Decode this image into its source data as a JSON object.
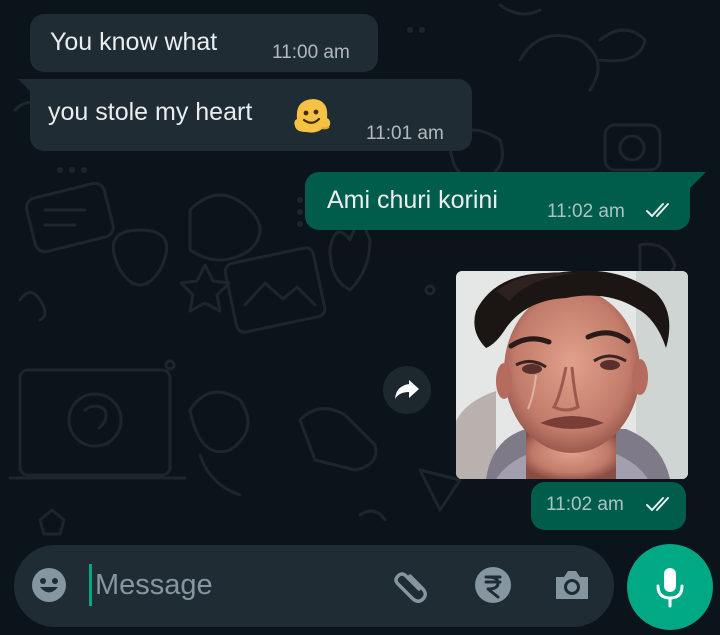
{
  "chat": {
    "messages": [
      {
        "direction": "incoming",
        "text": "You know what",
        "time": "11:00 am"
      },
      {
        "direction": "incoming",
        "text": "you stole my heart",
        "emoji": "melting-face",
        "time": "11:01 am"
      },
      {
        "direction": "outgoing",
        "text": "Ami churi korini",
        "time": "11:02 am",
        "status": "read"
      },
      {
        "direction": "outgoing",
        "type": "image",
        "image": "crying-man-photo",
        "time": "11:02 am",
        "status": "read"
      }
    ]
  },
  "composer": {
    "placeholder": "Message",
    "icons": [
      "emoji-icon",
      "attachment-icon",
      "rupee-payment-icon",
      "camera-icon",
      "microphone-icon"
    ]
  },
  "colors": {
    "background": "#0b141a",
    "incoming_bubble": "#202c33",
    "outgoing_bubble": "#005c4b",
    "accent": "#00a884",
    "read_ticks": "#e9edef"
  }
}
